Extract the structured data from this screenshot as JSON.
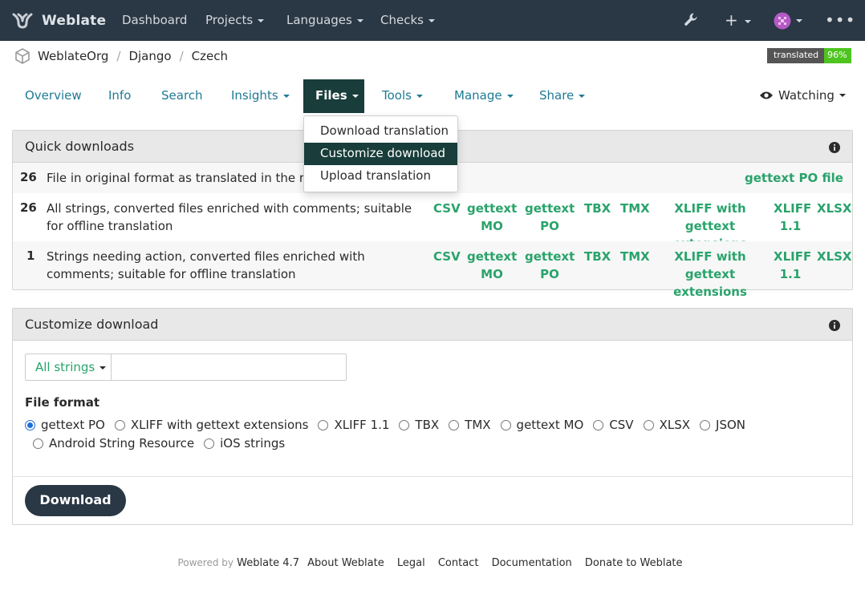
{
  "brand": {
    "name": "Weblate"
  },
  "nav": {
    "dashboard": "Dashboard",
    "projects": "Projects",
    "languages": "Languages",
    "checks": "Checks"
  },
  "breadcrumb": {
    "org": "WeblateOrg",
    "project": "Django",
    "language": "Czech"
  },
  "badge": {
    "label": "translated",
    "value": "96%"
  },
  "tabs": {
    "overview": "Overview",
    "info": "Info",
    "search": "Search",
    "insights": "Insights",
    "files": "Files",
    "tools": "Tools",
    "manage": "Manage",
    "share": "Share",
    "watching": "Watching"
  },
  "files_menu": {
    "items": [
      "Download translation",
      "Customize download",
      "Upload translation"
    ],
    "active_index": 1
  },
  "quick": {
    "title": "Quick downloads",
    "rows": [
      {
        "count": "26",
        "desc": "File in original format as translated in the repository",
        "links": [
          "gettext PO file"
        ]
      },
      {
        "count": "26",
        "desc": "All strings, converted files enriched with comments; suitable for offline translation",
        "links": [
          "CSV",
          "gettext MO",
          "gettext PO",
          "TBX",
          "TMX",
          "XLIFF with gettext extensions",
          "XLIFF 1.1",
          "XLSX"
        ]
      },
      {
        "count": "1",
        "desc": "Strings needing action, converted files enriched with comments; suitable for offline translation",
        "links": [
          "CSV",
          "gettext MO",
          "gettext PO",
          "TBX",
          "TMX",
          "XLIFF with gettext extensions",
          "XLIFF 1.1",
          "XLSX"
        ]
      }
    ]
  },
  "customize": {
    "title": "Customize download",
    "filter": "All strings",
    "query_value": "",
    "file_format_label": "File format",
    "formats": [
      "gettext PO",
      "XLIFF with gettext extensions",
      "XLIFF 1.1",
      "TBX",
      "TMX",
      "gettext MO",
      "CSV",
      "XLSX",
      "JSON",
      "Android String Resource",
      "iOS strings"
    ],
    "selected_format": "gettext PO",
    "download_label": "Download"
  },
  "footer": {
    "powered_by": "Powered by",
    "version": "Weblate 4.7",
    "links": [
      "About Weblate",
      "Legal",
      "Contact",
      "Documentation",
      "Donate to Weblate"
    ]
  },
  "colors": {
    "navbar": "#2a3744",
    "accent": "#183d3a",
    "link": "#2aa36b",
    "tab": "#1f7a94"
  }
}
